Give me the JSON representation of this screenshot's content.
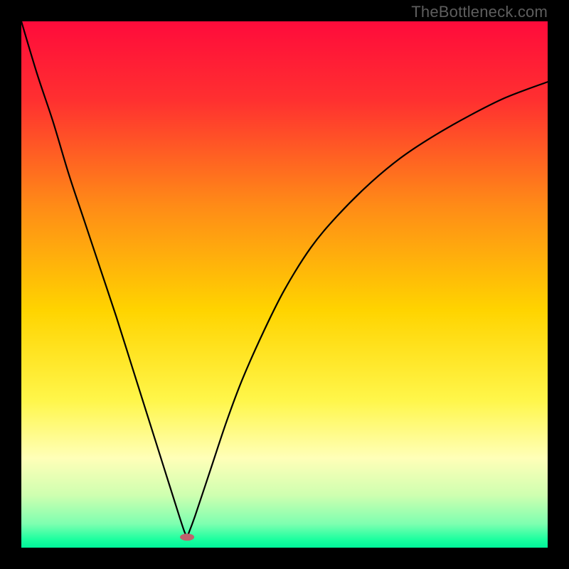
{
  "watermark": "TheBottleneck.com",
  "chart_data": {
    "type": "line",
    "title": "",
    "xlabel": "",
    "ylabel": "",
    "xlim": [
      0,
      100
    ],
    "ylim": [
      0,
      100
    ],
    "background_gradient": {
      "stops": [
        {
          "offset": 0.0,
          "color": "#ff0b3b"
        },
        {
          "offset": 0.15,
          "color": "#ff3030"
        },
        {
          "offset": 0.35,
          "color": "#ff8b17"
        },
        {
          "offset": 0.55,
          "color": "#ffd400"
        },
        {
          "offset": 0.72,
          "color": "#fff64a"
        },
        {
          "offset": 0.83,
          "color": "#ffffb8"
        },
        {
          "offset": 0.9,
          "color": "#cfffb0"
        },
        {
          "offset": 0.955,
          "color": "#7dffb0"
        },
        {
          "offset": 0.985,
          "color": "#1aff9f"
        },
        {
          "offset": 1.0,
          "color": "#00f49a"
        }
      ]
    },
    "min_marker": {
      "x": 31.5,
      "y": 2,
      "color": "#c0616d"
    },
    "series": [
      {
        "name": "left-branch",
        "x": [
          0,
          3,
          6,
          9,
          12,
          15,
          18,
          21,
          24,
          27,
          30,
          31,
          31.5
        ],
        "y": [
          100,
          90,
          81,
          71,
          62,
          53,
          44,
          34.5,
          25,
          15.5,
          6,
          3,
          2
        ]
      },
      {
        "name": "right-branch",
        "x": [
          31.5,
          33,
          36,
          39,
          42,
          46,
          50,
          55,
          60,
          66,
          72,
          78,
          85,
          92,
          100
        ],
        "y": [
          2,
          6,
          15,
          24,
          32,
          41,
          49,
          57,
          63,
          69,
          74,
          78,
          82,
          85.5,
          88.5
        ]
      }
    ]
  }
}
